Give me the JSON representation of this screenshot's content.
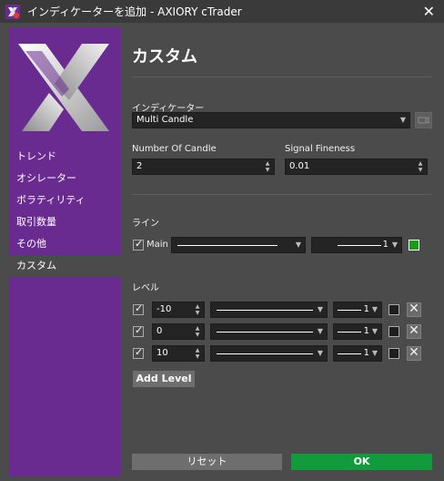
{
  "window": {
    "title": "インディケーターを追加 - AXIORY cTrader",
    "close_glyph": "✕"
  },
  "sidebar": {
    "items": [
      {
        "label": "トレンド"
      },
      {
        "label": "オシレーター"
      },
      {
        "label": "ボラティリティ"
      },
      {
        "label": "取引数量"
      },
      {
        "label": "その他"
      },
      {
        "label": "カスタム",
        "active": true
      }
    ]
  },
  "main": {
    "heading": "カスタム",
    "indicator": {
      "label": "インディケーター",
      "value": "Multi Candle"
    },
    "number_of_candle": {
      "label": "Number Of Candle",
      "value": "2"
    },
    "signal_fineness": {
      "label": "Signal Fineness",
      "value": "0.01"
    },
    "lines": {
      "label": "ライン",
      "main": {
        "checked": true,
        "label": "Main",
        "thickness": "1",
        "color": "#1a9a1a"
      }
    },
    "levels": {
      "label": "レベル",
      "rows": [
        {
          "checked": true,
          "value": "-10",
          "thickness": "1"
        },
        {
          "checked": true,
          "value": "0",
          "thickness": "1"
        },
        {
          "checked": true,
          "value": "10",
          "thickness": "1"
        }
      ],
      "add_label": "Add Level",
      "delete_glyph": "✕"
    },
    "reset_label": "リセット",
    "ok_label": "OK"
  },
  "colors": {
    "sidebar": "#6a2b91",
    "ok": "#129b3c",
    "reset": "#6e6e6e"
  }
}
